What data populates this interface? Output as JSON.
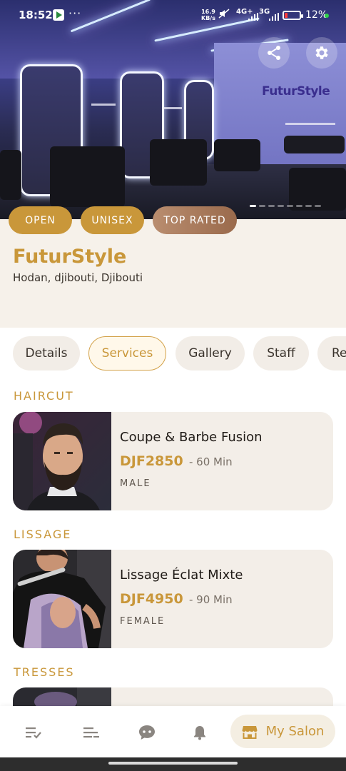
{
  "status_bar": {
    "time": "18:52",
    "net_speed_value": "16.9",
    "net_speed_unit": "KB/s",
    "signal_1": "4G+",
    "signal_2": "3G",
    "battery_percent": "12%"
  },
  "hero": {
    "logo_text": "FuturStyle",
    "share_icon": "share-icon",
    "settings_icon": "gear-icon",
    "image_pages": 8,
    "active_page": 0
  },
  "badges": {
    "open": "OPEN",
    "unisex": "UNISEX",
    "top_rated": "TOP RATED"
  },
  "salon": {
    "name": "FuturStyle",
    "location": "Hodan, djibouti, Djibouti"
  },
  "tabs": [
    {
      "label": "Details",
      "active": false
    },
    {
      "label": "Services",
      "active": true
    },
    {
      "label": "Gallery",
      "active": false
    },
    {
      "label": "Staff",
      "active": false
    },
    {
      "label": "Re",
      "active": false
    }
  ],
  "sections": [
    {
      "title": "HAIRCUT",
      "service": {
        "name": "Coupe & Barbe Fusion",
        "price": "DJF2850",
        "duration": "- 60 Min",
        "gender": "MALE"
      }
    },
    {
      "title": "LISSAGE",
      "service": {
        "name": "Lissage Éclat Mixte",
        "price": "DJF4950",
        "duration": "- 90 Min",
        "gender": "FEMALE"
      }
    },
    {
      "title": "TRESSES"
    }
  ],
  "bottom_nav": {
    "items": [
      "bookings-icon",
      "list-icon",
      "chat-icon",
      "bell-icon"
    ],
    "active_label": "My Salon"
  },
  "colors": {
    "accent_gold": "#c9973a",
    "card_bg": "#f3eee8",
    "header_bg": "#f6f1ea"
  }
}
